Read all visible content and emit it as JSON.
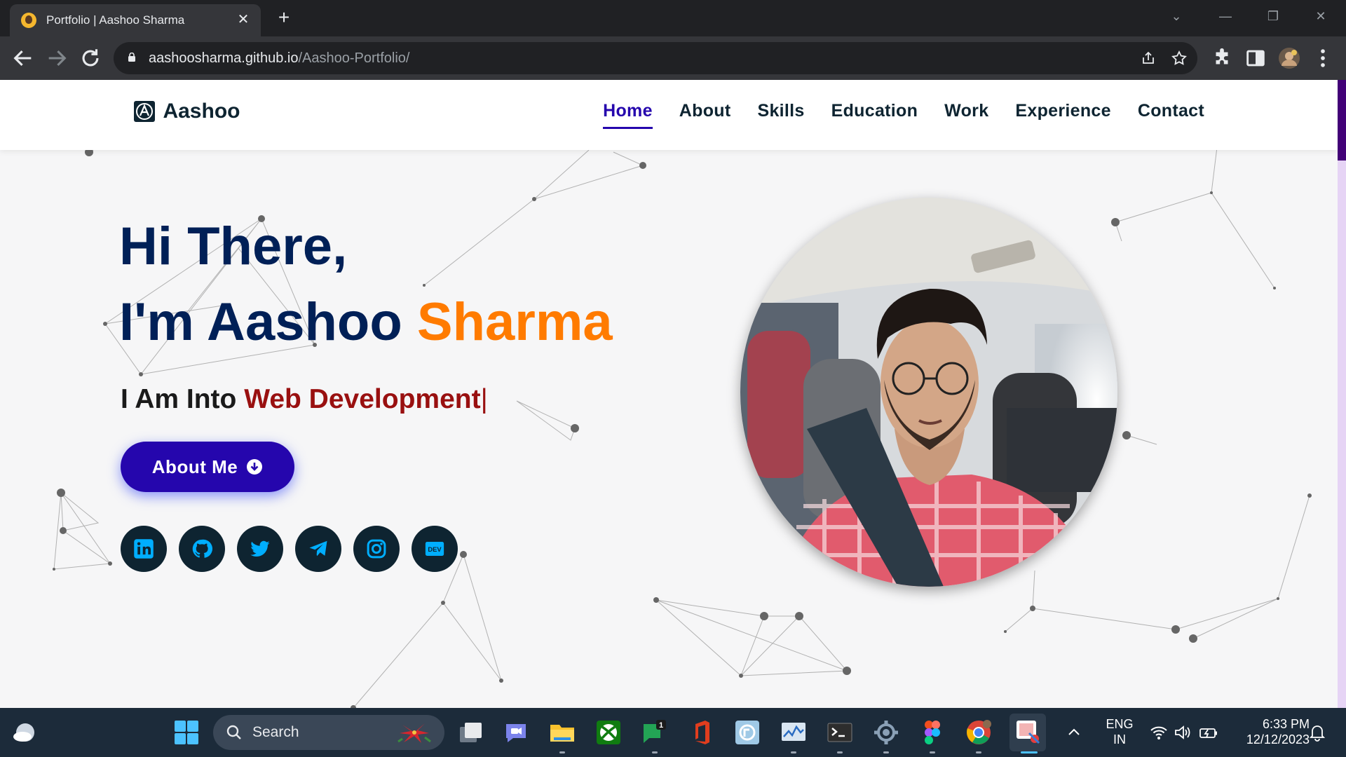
{
  "browser": {
    "tab_title": "Portfolio | Aashoo Sharma",
    "url_host": "aashoosharma.github.io",
    "url_path": "/Aashoo-Portfolio/"
  },
  "site": {
    "logo_text": "Aashoo",
    "nav": [
      {
        "label": "Home",
        "active": true
      },
      {
        "label": "About",
        "active": false
      },
      {
        "label": "Skills",
        "active": false
      },
      {
        "label": "Education",
        "active": false
      },
      {
        "label": "Work",
        "active": false
      },
      {
        "label": "Experience",
        "active": false
      },
      {
        "label": "Contact",
        "active": false
      }
    ],
    "hero": {
      "greeting": "Hi There,",
      "name_prefix": "I'm Aashoo ",
      "name_accent": "Sharma",
      "typing_prefix": "I Am Into ",
      "typing_value": "Web Development",
      "typing_cursor": "|",
      "button_label": "About Me"
    },
    "socials": [
      "linkedin-icon",
      "github-icon",
      "twitter-icon",
      "telegram-icon",
      "instagram-icon",
      "dev-icon"
    ],
    "colors": {
      "primary": "#2506ad",
      "heading": "#002057",
      "accent": "#ff7b00",
      "typed": "#991010",
      "social_bg": "#0e2431",
      "social_icon": "#00aeff"
    }
  },
  "taskbar": {
    "search_label": "Search",
    "lang_1": "ENG",
    "lang_2": "IN",
    "time": "6:33 PM",
    "date": "12/12/2023",
    "chat_badge": "1"
  }
}
